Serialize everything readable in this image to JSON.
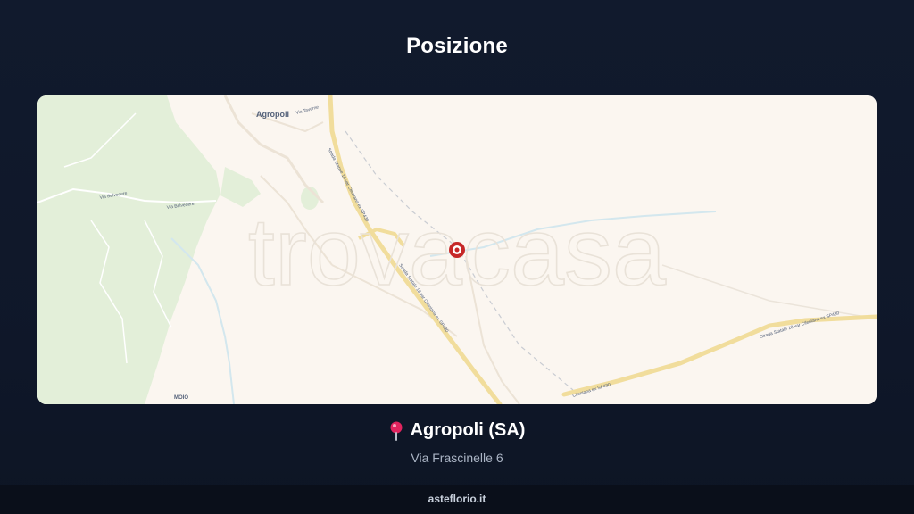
{
  "page": {
    "title": "Posizione"
  },
  "map": {
    "watermark": "trovacasa",
    "labels": {
      "agropoli": "Agropoli",
      "moio": "MOIO",
      "via_belvedere_1": "Via Belvedere",
      "via_belvedere_2": "Via Belvedere",
      "via_taverne": "Via Taverne",
      "ss18_1": "Strada Statale 18 var Cilentana ex SP430",
      "ss18_2": "Strada Statale 18 var Cilentana ex SP430",
      "ss18_3": "Strada Statale 18 var Cilentana ex SP430",
      "cilentana_sp430": "Cilentana ex SP430"
    },
    "colors": {
      "land": "#fbf6f0",
      "forest": "#e3efd9",
      "road": "#f1dd9c",
      "marker": "#c62828"
    }
  },
  "location": {
    "name": "Agropoli (SA)",
    "address": "Via Frascinelle 6",
    "pin_icon": "map-pin-icon"
  },
  "footer": {
    "brand": "asteflorio.it"
  }
}
